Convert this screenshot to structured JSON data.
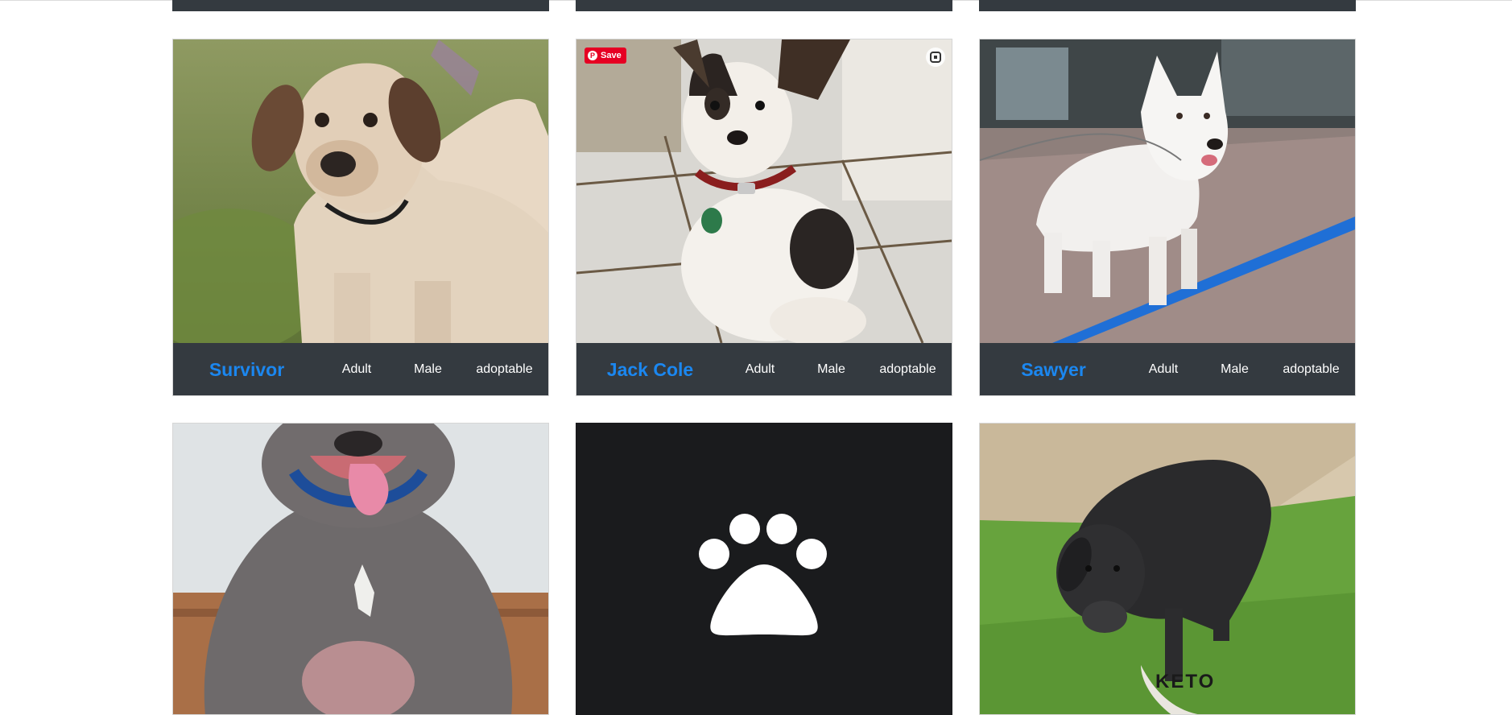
{
  "pets": [
    {
      "name": "Survivor",
      "age": "Adult",
      "sex": "Male",
      "status": "adoptable",
      "photo": "tan-hound-dog-photo"
    },
    {
      "name": "Jack Cole",
      "age": "Adult",
      "sex": "Male",
      "status": "adoptable",
      "photo": "black-white-chihuahua-photo"
    },
    {
      "name": "Sawyer",
      "age": "Adult",
      "sex": "Male",
      "status": "adoptable",
      "photo": "white-shepherd-dog-photo"
    },
    {
      "photo": "gray-pitbull-photo"
    },
    {
      "photo": "paw-placeholder",
      "icon": "paw-icon"
    },
    {
      "photo": "black-terrier-photo",
      "photo_caption": "KETO"
    }
  ],
  "pinterest": {
    "save_label": "Save",
    "logo": "P"
  },
  "colors": {
    "name_link": "#1b87f0",
    "info_bar": "#343a40",
    "placeholder_bg": "#1a1b1d",
    "pinterest_red": "#e60023"
  }
}
